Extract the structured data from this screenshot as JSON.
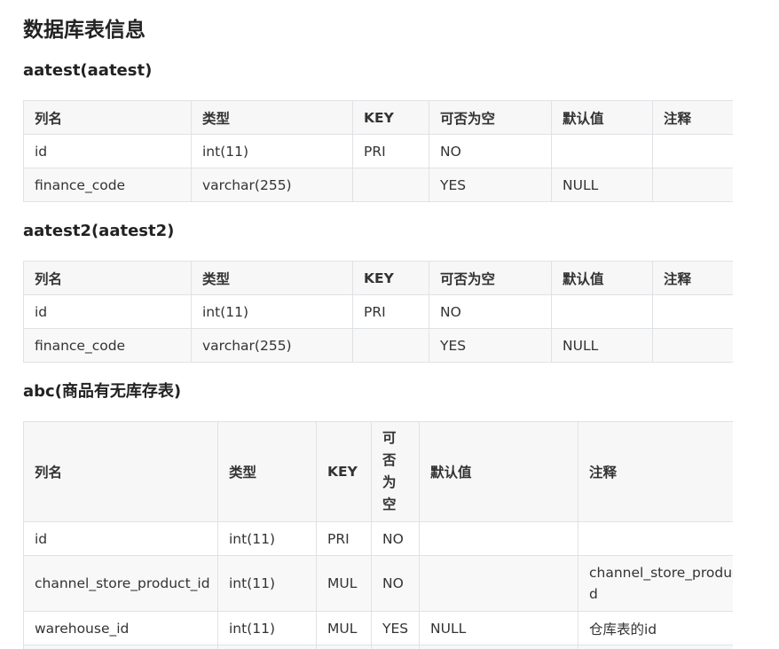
{
  "title": "数据库表信息",
  "headers": [
    "列名",
    "类型",
    "KEY",
    "可否为空",
    "默认值",
    "注释"
  ],
  "tables": [
    {
      "name": "aatest(aatest)",
      "rows": [
        [
          "id",
          "int(11)",
          "PRI",
          "NO",
          "",
          ""
        ],
        [
          "finance_code",
          "varchar(255)",
          "",
          "YES",
          "NULL",
          ""
        ]
      ]
    },
    {
      "name": "aatest2(aatest2)",
      "rows": [
        [
          "id",
          "int(11)",
          "PRI",
          "NO",
          "",
          ""
        ],
        [
          "finance_code",
          "varchar(255)",
          "",
          "YES",
          "NULL",
          ""
        ]
      ]
    },
    {
      "name": "abc(商品有无库存表)",
      "rows": [
        [
          "id",
          "int(11)",
          "PRI",
          "NO",
          "",
          ""
        ],
        [
          "channel_store_product_id",
          "int(11)",
          "MUL",
          "NO",
          "",
          "channel_store_product的关联id"
        ],
        [
          "warehouse_id",
          "int(11)",
          "MUL",
          "YES",
          "NULL",
          "仓库表的id"
        ]
      ]
    }
  ]
}
